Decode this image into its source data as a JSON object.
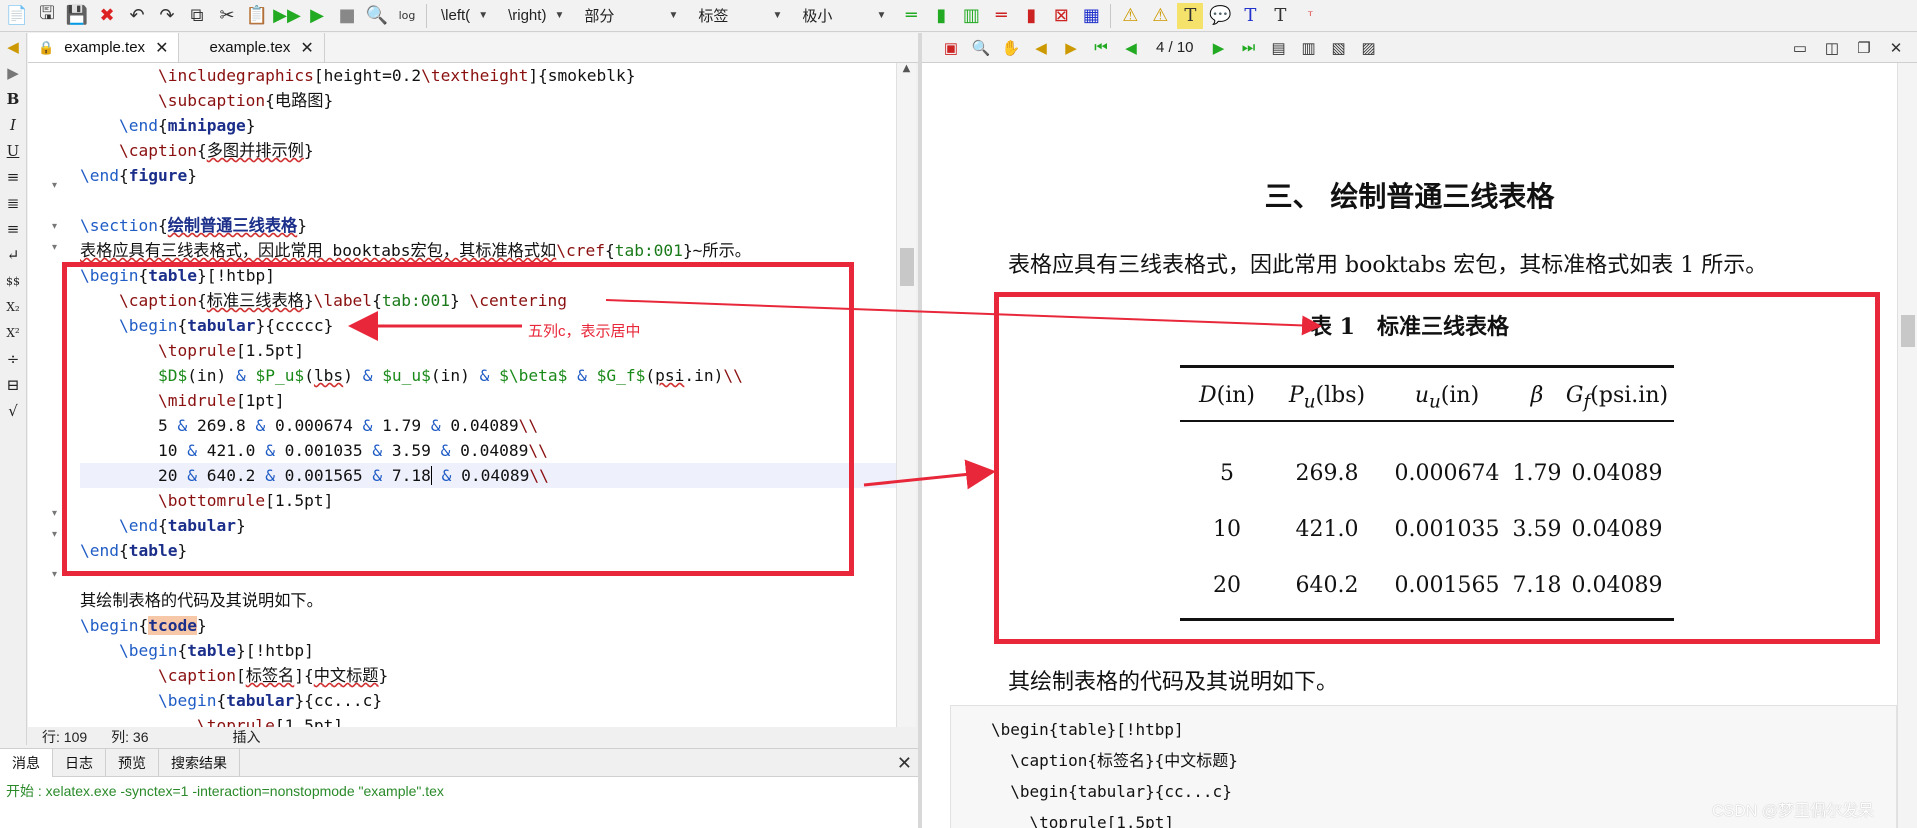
{
  "toolbar": {
    "left_label": "\\left(",
    "right_label": "\\right)",
    "section_label": "部分",
    "label_label": "标签",
    "size_label": "极小"
  },
  "editor_tabs": [
    {
      "label": "example.tex"
    },
    {
      "label": "example.tex"
    }
  ],
  "status": {
    "row_label": "行:",
    "row": "109",
    "col_label": "列:",
    "col": "36",
    "mode": "插入"
  },
  "bottom_tabs": [
    "消息",
    "日志",
    "预览",
    "搜索结果"
  ],
  "bottom_message": "开始 : xelatex.exe -synctex=1 -interaction=nonstopmode \"example\".tex",
  "pdf": {
    "page_indicator": "4 / 10",
    "section_title": "三、 绘制普通三线表格",
    "paragraph": "表格应具有三线表格式，因此常用 booktabs 宏包，其标准格式如表 1 所示。",
    "table_caption": "表 1　标准三线表格",
    "table_headers": [
      "D(in)",
      "Pu(lbs)",
      "uu(in)",
      "β",
      "Gf(psi.in)"
    ],
    "table_rows": [
      [
        "5",
        "269.8",
        "0.000674",
        "1.79",
        "0.04089"
      ],
      [
        "10",
        "421.0",
        "0.001035",
        "3.59",
        "0.04089"
      ],
      [
        "20",
        "640.2",
        "0.001565",
        "7.18",
        "0.04089"
      ]
    ],
    "paragraph2": "其绘制表格的代码及其说明如下。",
    "code_lines": [
      "\\begin{table}[!htbp]",
      "  \\caption{标签名}{中文标题}",
      "  \\begin{tabular}{cc...c}",
      "    \\toprule[1.5pt]"
    ]
  },
  "annotation": "五列c，表示居中",
  "watermark": "CSDN @梦里偶尔发呆",
  "colors": {
    "highlight": "#e8283a",
    "keyword": "#1f5cc5",
    "command": "#8a1010"
  }
}
